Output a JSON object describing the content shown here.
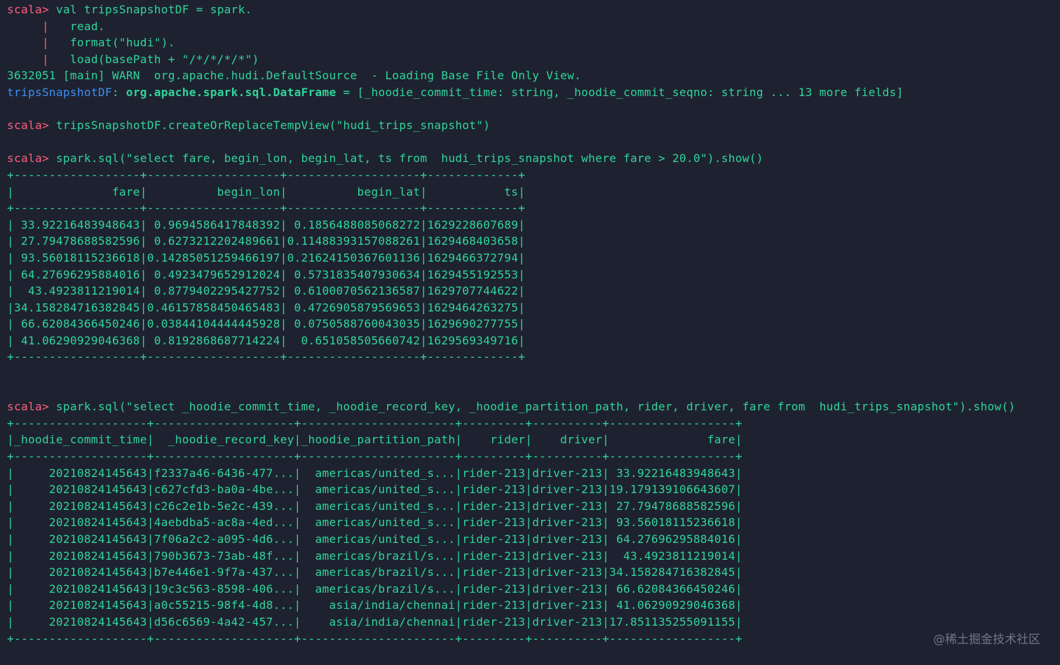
{
  "colors": {
    "background": "#1e2230",
    "prompt": "#ff5e7c",
    "text": "#30d59b",
    "variable": "#3e8ff4",
    "watermark": "#6f7686"
  },
  "lines": [
    {
      "segs": [
        {
          "t": "scala> ",
          "c": "prompt"
        },
        {
          "t": "val tripsSnapshotDF = spark.",
          "c": "green"
        }
      ]
    },
    {
      "segs": [
        {
          "t": "     |   ",
          "c": "prompt"
        },
        {
          "t": "read.",
          "c": "green"
        }
      ]
    },
    {
      "segs": [
        {
          "t": "     |   ",
          "c": "prompt"
        },
        {
          "t": "format(\"hudi\").",
          "c": "green"
        }
      ]
    },
    {
      "segs": [
        {
          "t": "     |   ",
          "c": "prompt"
        },
        {
          "t": "load(basePath + \"/*/*/*/*\")",
          "c": "green"
        }
      ]
    },
    {
      "segs": [
        {
          "t": "3632051 [main] WARN  org.apache.hudi.DefaultSource  - Loading Base File Only View.",
          "c": "green"
        }
      ]
    },
    {
      "segs": [
        {
          "t": "tripsSnapshotDF",
          "c": "blue"
        },
        {
          "t": ": ",
          "c": "green"
        },
        {
          "t": "org.apache.spark.sql.DataFrame",
          "c": "bold"
        },
        {
          "t": " = [_hoodie_commit_time: string, _hoodie_commit_seqno: string ... 13 more fields]",
          "c": "green"
        }
      ]
    },
    {
      "segs": [
        {
          "t": "",
          "c": "green"
        }
      ]
    },
    {
      "segs": [
        {
          "t": "scala> ",
          "c": "prompt"
        },
        {
          "t": "tripsSnapshotDF.createOrReplaceTempView(\"hudi_trips_snapshot\")",
          "c": "green"
        }
      ]
    },
    {
      "segs": [
        {
          "t": "",
          "c": "green"
        }
      ]
    },
    {
      "segs": [
        {
          "t": "scala> ",
          "c": "prompt"
        },
        {
          "t": "spark.sql(\"select fare, begin_lon, begin_lat, ts from  hudi_trips_snapshot where fare > 20.0\").show()",
          "c": "green"
        }
      ]
    },
    {
      "segs": [
        {
          "t": "+------------------+-------------------+-------------------+-------------+",
          "c": "green"
        }
      ]
    },
    {
      "segs": [
        {
          "t": "|              fare|          begin_lon|          begin_lat|           ts|",
          "c": "green"
        }
      ]
    },
    {
      "segs": [
        {
          "t": "+------------------+-------------------+-------------------+-------------+",
          "c": "green"
        }
      ]
    },
    {
      "segs": [
        {
          "t": "| 33.92216483948643| 0.9694586417848392| 0.1856488085068272|1629228607689|",
          "c": "green"
        }
      ]
    },
    {
      "segs": [
        {
          "t": "| 27.79478688582596| 0.6273212202489661|0.11488393157088261|1629468403658|",
          "c": "green"
        }
      ]
    },
    {
      "segs": [
        {
          "t": "| 93.56018115236618|0.14285051259466197|0.21624150367601136|1629466372794|",
          "c": "green"
        }
      ]
    },
    {
      "segs": [
        {
          "t": "| 64.27696295884016| 0.4923479652912024| 0.5731835407930634|1629455192553|",
          "c": "green"
        }
      ]
    },
    {
      "segs": [
        {
          "t": "|  43.4923811219014| 0.8779402295427752| 0.6100070562136587|1629707744622|",
          "c": "green"
        }
      ]
    },
    {
      "segs": [
        {
          "t": "|34.158284716382845|0.46157858450465483| 0.4726905879569653|1629464263275|",
          "c": "green"
        }
      ]
    },
    {
      "segs": [
        {
          "t": "| 66.62084366450246|0.03844104444445928| 0.0750588760043035|1629690277755|",
          "c": "green"
        }
      ]
    },
    {
      "segs": [
        {
          "t": "| 41.06290929046368| 0.8192868687714224|  0.651058505660742|1629569349716|",
          "c": "green"
        }
      ]
    },
    {
      "segs": [
        {
          "t": "+------------------+-------------------+-------------------+-------------+",
          "c": "green"
        }
      ]
    },
    {
      "segs": [
        {
          "t": "",
          "c": "green"
        }
      ]
    },
    {
      "segs": [
        {
          "t": "",
          "c": "green"
        }
      ]
    },
    {
      "segs": [
        {
          "t": "scala> ",
          "c": "prompt"
        },
        {
          "t": "spark.sql(\"select _hoodie_commit_time, _hoodie_record_key, _hoodie_partition_path, rider, driver, fare from  hudi_trips_snapshot\").show()",
          "c": "green"
        }
      ]
    },
    {
      "segs": [
        {
          "t": "+-------------------+--------------------+----------------------+---------+----------+------------------+",
          "c": "green"
        }
      ]
    },
    {
      "segs": [
        {
          "t": "|_hoodie_commit_time|  _hoodie_record_key|_hoodie_partition_path|    rider|    driver|              fare|",
          "c": "green"
        }
      ]
    },
    {
      "segs": [
        {
          "t": "+-------------------+--------------------+----------------------+---------+----------+------------------+",
          "c": "green"
        }
      ]
    },
    {
      "segs": [
        {
          "t": "|     20210824145643|f2337a46-6436-477...|  americas/united_s...|rider-213|driver-213| 33.92216483948643|",
          "c": "green"
        }
      ]
    },
    {
      "segs": [
        {
          "t": "|     20210824145643|c627cfd3-ba0a-4be...|  americas/united_s...|rider-213|driver-213|19.179139106643607|",
          "c": "green"
        }
      ]
    },
    {
      "segs": [
        {
          "t": "|     20210824145643|c26c2e1b-5e2c-439...|  americas/united_s...|rider-213|driver-213| 27.79478688582596|",
          "c": "green"
        }
      ]
    },
    {
      "segs": [
        {
          "t": "|     20210824145643|4aebdba5-ac8a-4ed...|  americas/united_s...|rider-213|driver-213| 93.56018115236618|",
          "c": "green"
        }
      ]
    },
    {
      "segs": [
        {
          "t": "|     20210824145643|7f06a2c2-a095-4d6...|  americas/united_s...|rider-213|driver-213| 64.27696295884016|",
          "c": "green"
        }
      ]
    },
    {
      "segs": [
        {
          "t": "|     20210824145643|790b3673-73ab-48f...|  americas/brazil/s...|rider-213|driver-213|  43.4923811219014|",
          "c": "green"
        }
      ]
    },
    {
      "segs": [
        {
          "t": "|     20210824145643|b7e446e1-9f7a-437...|  americas/brazil/s...|rider-213|driver-213|34.158284716382845|",
          "c": "green"
        }
      ]
    },
    {
      "segs": [
        {
          "t": "|     20210824145643|19c3c563-8598-406...|  americas/brazil/s...|rider-213|driver-213| 66.62084366450246|",
          "c": "green"
        }
      ]
    },
    {
      "segs": [
        {
          "t": "|     20210824145643|a0c55215-98f4-4d8...|    asia/india/chennai|rider-213|driver-213| 41.06290929046368|",
          "c": "green"
        }
      ]
    },
    {
      "segs": [
        {
          "t": "|     20210824145643|d56c6569-4a42-457...|    asia/india/chennai|rider-213|driver-213|17.851135255091155|",
          "c": "green"
        }
      ]
    },
    {
      "segs": [
        {
          "t": "+-------------------+--------------------+----------------------+---------+----------+------------------+",
          "c": "green"
        }
      ]
    }
  ],
  "watermark": "@稀土掘金技术社区"
}
